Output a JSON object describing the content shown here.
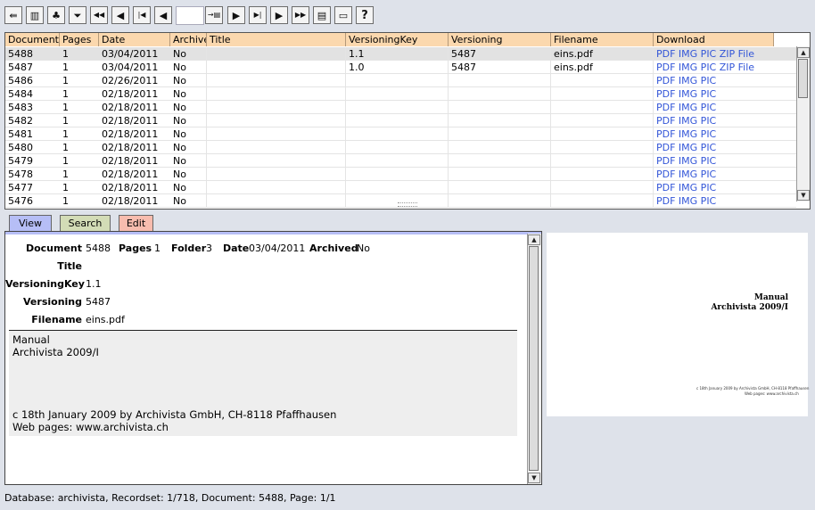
{
  "toolbar": {
    "buttons": [
      {
        "name": "logout-button",
        "icon": "exit-door-icon",
        "glyph": "⇚"
      },
      {
        "name": "table-view-button",
        "icon": "table-columns-icon",
        "glyph": "▥"
      },
      {
        "name": "tree-button",
        "icon": "tree-icon",
        "glyph": "♣"
      },
      {
        "name": "filter-button",
        "icon": "filter-funnel-icon",
        "glyph": "⏷"
      },
      {
        "name": "first-page-button",
        "icon": "double-left-icon",
        "glyph": "◀◀"
      },
      {
        "name": "prev-page-button",
        "icon": "left-arrow-icon",
        "glyph": "◀"
      },
      {
        "name": "first-record-button",
        "icon": "first-record-icon",
        "glyph": "|◀"
      },
      {
        "name": "prev-record-button",
        "icon": "prev-record-icon",
        "glyph": "◀"
      },
      {
        "name": "goto-button",
        "icon": "goto-icon",
        "glyph": "→▤"
      },
      {
        "name": "next-record-button",
        "icon": "next-record-icon",
        "glyph": "▶"
      },
      {
        "name": "last-record-button",
        "icon": "last-record-icon",
        "glyph": "▶|"
      },
      {
        "name": "next-page-button",
        "icon": "right-arrow-icon",
        "glyph": "▶"
      },
      {
        "name": "last-page-button",
        "icon": "double-right-icon",
        "glyph": "▶▶"
      },
      {
        "name": "scan-button",
        "icon": "scanner-icon",
        "glyph": "▤"
      },
      {
        "name": "open-folder-button",
        "icon": "folder-icon",
        "glyph": "▭"
      },
      {
        "name": "help-button",
        "icon": "question-icon",
        "glyph": "?"
      }
    ],
    "record_input_value": ""
  },
  "grid": {
    "columns": [
      "Document",
      "Pages",
      "Date",
      "Archived",
      "Title",
      "VersioningKey",
      "Versioning",
      "Filename",
      "Download"
    ],
    "rows": [
      {
        "doc": "5488",
        "pages": "1",
        "date": "03/04/2011",
        "archived": "No",
        "title": "",
        "vkey": "1.1",
        "versioning": "5487",
        "filename": "eins.pdf",
        "download": "PDF IMG PIC ZIP File"
      },
      {
        "doc": "5487",
        "pages": "1",
        "date": "03/04/2011",
        "archived": "No",
        "title": "",
        "vkey": "1.0",
        "versioning": "5487",
        "filename": "eins.pdf",
        "download": "PDF IMG PIC ZIP File"
      },
      {
        "doc": "5486",
        "pages": "1",
        "date": "02/26/2011",
        "archived": "No",
        "title": "",
        "vkey": "",
        "versioning": "",
        "filename": "",
        "download": "PDF IMG PIC"
      },
      {
        "doc": "5484",
        "pages": "1",
        "date": "02/18/2011",
        "archived": "No",
        "title": "",
        "vkey": "",
        "versioning": "",
        "filename": "",
        "download": "PDF IMG PIC"
      },
      {
        "doc": "5483",
        "pages": "1",
        "date": "02/18/2011",
        "archived": "No",
        "title": "",
        "vkey": "",
        "versioning": "",
        "filename": "",
        "download": "PDF IMG PIC"
      },
      {
        "doc": "5482",
        "pages": "1",
        "date": "02/18/2011",
        "archived": "No",
        "title": "",
        "vkey": "",
        "versioning": "",
        "filename": "",
        "download": "PDF IMG PIC"
      },
      {
        "doc": "5481",
        "pages": "1",
        "date": "02/18/2011",
        "archived": "No",
        "title": "",
        "vkey": "",
        "versioning": "",
        "filename": "",
        "download": "PDF IMG PIC"
      },
      {
        "doc": "5480",
        "pages": "1",
        "date": "02/18/2011",
        "archived": "No",
        "title": "",
        "vkey": "",
        "versioning": "",
        "filename": "",
        "download": "PDF IMG PIC"
      },
      {
        "doc": "5479",
        "pages": "1",
        "date": "02/18/2011",
        "archived": "No",
        "title": "",
        "vkey": "",
        "versioning": "",
        "filename": "",
        "download": "PDF IMG PIC"
      },
      {
        "doc": "5478",
        "pages": "1",
        "date": "02/18/2011",
        "archived": "No",
        "title": "",
        "vkey": "",
        "versioning": "",
        "filename": "",
        "download": "PDF IMG PIC"
      },
      {
        "doc": "5477",
        "pages": "1",
        "date": "02/18/2011",
        "archived": "No",
        "title": "",
        "vkey": "",
        "versioning": "",
        "filename": "",
        "download": "PDF IMG PIC"
      },
      {
        "doc": "5476",
        "pages": "1",
        "date": "02/18/2011",
        "archived": "No",
        "title": "",
        "vkey": "",
        "versioning": "",
        "filename": "",
        "download": "PDF IMG PIC"
      }
    ]
  },
  "tabs": [
    {
      "label": "View",
      "color": "#b6bef6"
    },
    {
      "label": "Search",
      "color": "#d3dcb6"
    },
    {
      "label": "Edit",
      "color": "#f8bcae"
    }
  ],
  "view": {
    "document_label": "Document",
    "document_value": "5488",
    "pages_label": "Pages",
    "pages_value": "1",
    "folder_label": "Folder",
    "folder_value": "3",
    "date_label": "Date",
    "date_value": "03/04/2011",
    "archived_label": "Archived",
    "archived_value": "No",
    "title_label": "Title",
    "title_value": "",
    "versioningkey_label": "VersioningKey",
    "versioningkey_value": "1.1",
    "versioning_label": "Versioning",
    "versioning_value": "5487",
    "filename_label": "Filename",
    "filename_value": "eins.pdf",
    "text_lines": [
      "Manual",
      "Archivista 2009/I",
      "",
      "",
      "",
      "",
      "c 18th January 2009 by Archivista GmbH, CH-8118 Pfaffhausen",
      "Web pages: www.archivista.ch"
    ]
  },
  "preview": {
    "title_line1": "Manual",
    "title_line2": "Archivista 2009/I",
    "footer_line1": "c 18th January 2009 by Archivista GmbH, CH-8118 Pfaffhausen",
    "footer_line2": "Web pages: www.archivista.ch"
  },
  "status": "Database: archivista, Recordset: 1/718, Document: 5488, Page: 1/1",
  "colors": {
    "selected_tab": "#b6bef6",
    "header": "#fbd8ae",
    "link": "#3356d8",
    "page_bg": "#dee2ea"
  }
}
